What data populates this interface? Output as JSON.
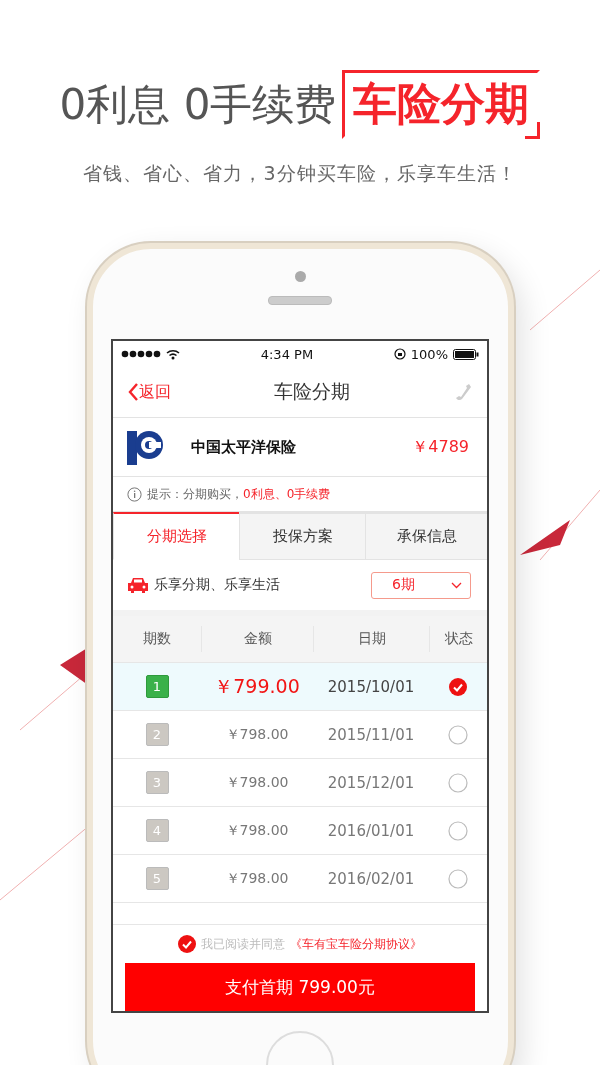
{
  "headline": {
    "text": "0利息 0手续费",
    "highlight": "车险分期"
  },
  "subtitle": "省钱、省心、省力，3分钟买车险，乐享车生活！",
  "status_bar": {
    "time": "4:34 PM",
    "battery": "100%"
  },
  "nav": {
    "back": "返回",
    "title": "车险分期"
  },
  "insurer": {
    "name": "中国太平洋保险",
    "price": "￥4789"
  },
  "notice": {
    "text": "提示：分期购买，",
    "highlight": "0利息、0手续费"
  },
  "tabs": [
    {
      "label": "分期选择",
      "selected": true
    },
    {
      "label": "投保方案",
      "selected": false
    },
    {
      "label": "承保信息",
      "selected": false
    }
  ],
  "plan": {
    "label": "乐享分期、乐享生活",
    "period": "6期"
  },
  "table": {
    "columns": [
      "期数",
      "金额",
      "日期",
      "状态"
    ],
    "rows": [
      {
        "index": "1",
        "amount": "￥799.00",
        "date": "2015/10/01",
        "selected": true
      },
      {
        "index": "2",
        "amount": "￥798.00",
        "date": "2015/11/01",
        "selected": false
      },
      {
        "index": "3",
        "amount": "￥798.00",
        "date": "2015/12/01",
        "selected": false
      },
      {
        "index": "4",
        "amount": "￥798.00",
        "date": "2016/01/01",
        "selected": false
      },
      {
        "index": "5",
        "amount": "￥798.00",
        "date": "2016/02/01",
        "selected": false
      }
    ]
  },
  "agreement": {
    "checked": true,
    "text": "我已阅读并同意",
    "link": "《车有宝车险分期协议》"
  },
  "pay_button": "支付首期 799.00元"
}
